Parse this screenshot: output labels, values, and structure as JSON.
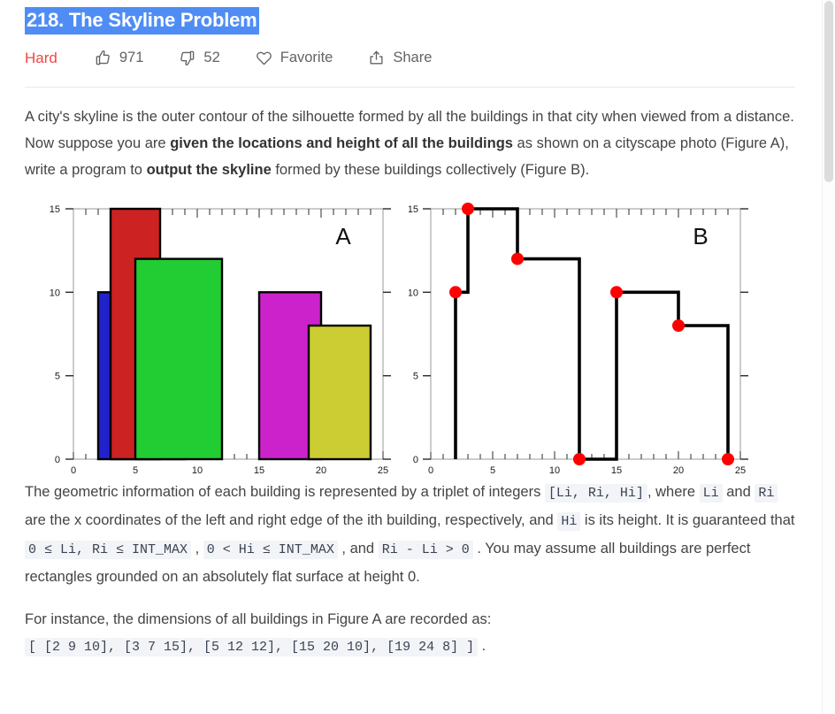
{
  "header": {
    "title": "218. The Skyline Problem",
    "difficulty": "Hard",
    "likes": "971",
    "dislikes": "52",
    "favorite_label": "Favorite",
    "share_label": "Share",
    "title_highlight_color": "#4f8df5",
    "difficulty_color": "#ef4743"
  },
  "body": {
    "p1_a": "A city's skyline is the outer contour of the silhouette formed by all the buildings in that city when viewed from a distance. Now suppose you are ",
    "p1_b": "given the locations and height of all the buildings",
    "p1_c": " as shown on a cityscape photo (Figure A), write a program to ",
    "p1_d": "output the skyline",
    "p1_e": " formed by these buildings collectively (Figure B).",
    "p2_a": "The geometric information of each building is represented by a triplet of integers ",
    "p2_code1": "[Li, Ri, Hi]",
    "p2_b": ", where ",
    "p2_code2": "Li",
    "p2_c": " and ",
    "p2_code3": "Ri",
    "p2_d": " are the x coordinates of the left and right edge of the ith building, respectively, and ",
    "p2_code4": "Hi",
    "p2_e": " is its height. It is guaranteed that ",
    "p2_code5": "0 ≤ Li, Ri ≤ INT_MAX",
    "p2_f": " , ",
    "p2_code6": "0 < Hi ≤ INT_MAX",
    "p2_g": " , and ",
    "p2_code7": "Ri - Li > 0",
    "p2_h": " . You may assume all buildings are perfect rectangles grounded on an absolutely flat surface at height 0.",
    "p3_a": "For instance, the dimensions of all buildings in Figure A are recorded as: ",
    "p3_code": "[ [2 9 10], [3 7 15], [5 12 12], [15 20 10], [19 24 8] ]",
    "p3_b": " ."
  },
  "chart_data": [
    {
      "type": "bar",
      "title": "A",
      "xlabel": "",
      "ylabel": "",
      "xlim": [
        0,
        25
      ],
      "ylim": [
        0,
        15
      ],
      "xticks": [
        0,
        5,
        10,
        15,
        20,
        25
      ],
      "yticks": [
        0,
        5,
        10,
        15
      ],
      "xtick_labels": [
        "0",
        "5",
        "10",
        "15",
        "20",
        "25"
      ],
      "ytick_labels": [
        "0",
        "5",
        "10",
        "15"
      ],
      "grid": false,
      "minor_ticks": true,
      "buildings": [
        {
          "name": "blue-building",
          "left": 2,
          "right": 9,
          "height": 10,
          "color": "#2222CC"
        },
        {
          "name": "red-building",
          "left": 3,
          "right": 7,
          "height": 15,
          "color": "#CC2222"
        },
        {
          "name": "green-building",
          "left": 5,
          "right": 12,
          "height": 12,
          "color": "#22CC33"
        },
        {
          "name": "magenta-building",
          "left": 15,
          "right": 20,
          "height": 10,
          "color": "#CC22CC"
        },
        {
          "name": "yellow-building",
          "left": 19,
          "right": 24,
          "height": 8,
          "color": "#CCCC33"
        }
      ]
    },
    {
      "type": "line",
      "title": "B",
      "xlabel": "",
      "ylabel": "",
      "xlim": [
        0,
        25
      ],
      "ylim": [
        0,
        15
      ],
      "xticks": [
        0,
        5,
        10,
        15,
        20,
        25
      ],
      "yticks": [
        0,
        5,
        10,
        15
      ],
      "xtick_labels": [
        "0",
        "5",
        "10",
        "15",
        "20",
        "25"
      ],
      "ytick_labels": [
        "0",
        "5",
        "10",
        "15"
      ],
      "grid": false,
      "minor_ticks": true,
      "line_color": "#000000",
      "point_color": "#FF0000",
      "key_points": [
        {
          "x": 2,
          "y": 10
        },
        {
          "x": 3,
          "y": 15
        },
        {
          "x": 7,
          "y": 12
        },
        {
          "x": 12,
          "y": 0
        },
        {
          "x": 15,
          "y": 10
        },
        {
          "x": 20,
          "y": 8
        },
        {
          "x": 24,
          "y": 0
        }
      ],
      "outline_path": [
        {
          "x": 2,
          "y": 0
        },
        {
          "x": 2,
          "y": 10
        },
        {
          "x": 3,
          "y": 10
        },
        {
          "x": 3,
          "y": 15
        },
        {
          "x": 7,
          "y": 15
        },
        {
          "x": 7,
          "y": 12
        },
        {
          "x": 12,
          "y": 12
        },
        {
          "x": 12,
          "y": 0
        },
        {
          "x": 15,
          "y": 0
        },
        {
          "x": 15,
          "y": 10
        },
        {
          "x": 20,
          "y": 10
        },
        {
          "x": 20,
          "y": 8
        },
        {
          "x": 24,
          "y": 8
        },
        {
          "x": 24,
          "y": 0
        }
      ]
    }
  ]
}
